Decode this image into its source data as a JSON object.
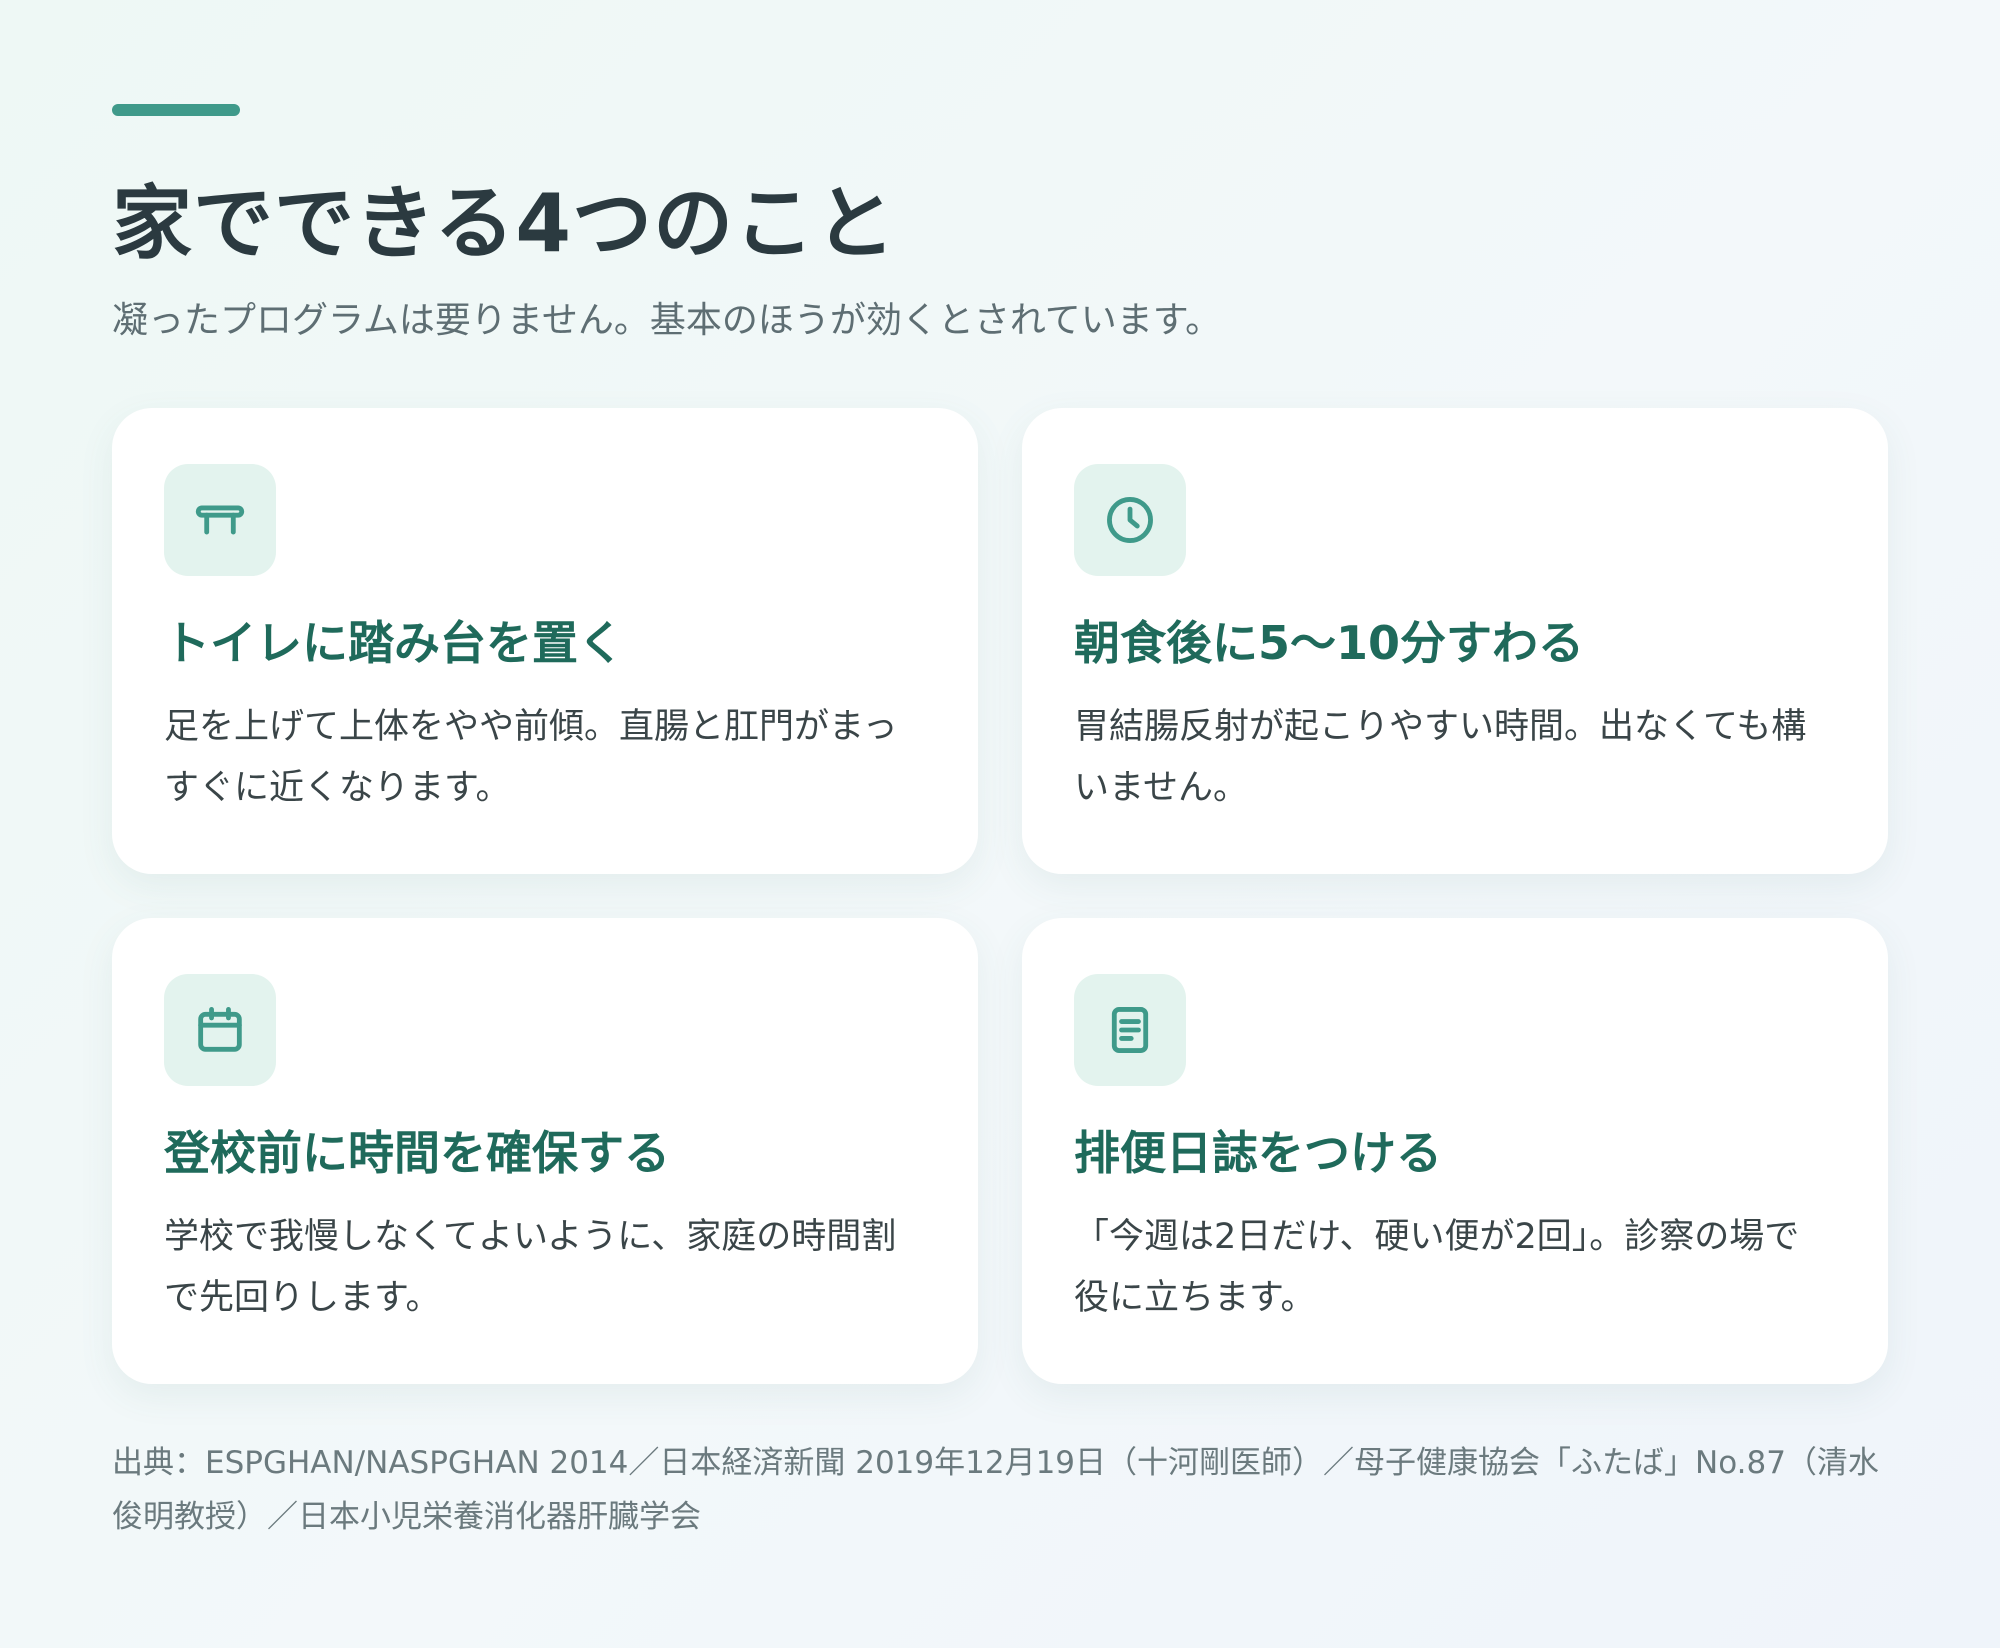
{
  "header": {
    "title": "家でできる4つのこと",
    "subtitle": "凝ったプログラムは要りません。基本のほうが効くとされています。"
  },
  "cards": [
    {
      "icon": "stool-icon",
      "title": "トイレに踏み台を置く",
      "text": "足を上げて上体をやや前傾。直腸と肛門がまっすぐに近くなります。"
    },
    {
      "icon": "clock-icon",
      "title": "朝食後に5〜10分すわる",
      "text": "胃結腸反射が起こりやすい時間。出なくても構いません。"
    },
    {
      "icon": "calendar-icon",
      "title": "登校前に時間を確保する",
      "text": "学校で我慢しなくてよいように、家庭の時間割で先回りします。"
    },
    {
      "icon": "notebook-icon",
      "title": "排便日誌をつける",
      "text": "「今週は2日だけ、硬い便が2回」。診察の場で役に立ちます。"
    }
  ],
  "source": "出典：ESPGHAN/NASPGHAN 2014／日本経済新聞 2019年12月19日（十河剛医師）／母子健康協会「ふたば」No.87（清水俊明教授）／日本小児栄養消化器肝臓学会",
  "colors": {
    "accent": "#3f9a8a",
    "card_title": "#1f6a5b",
    "icon_background": "#e3f3ee"
  }
}
